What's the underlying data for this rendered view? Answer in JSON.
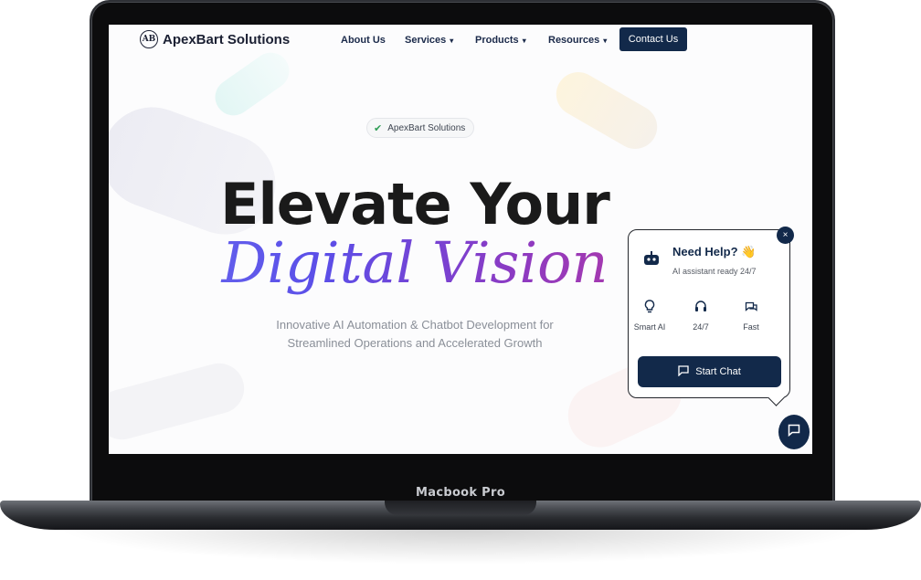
{
  "device": {
    "label": "Macbook Pro"
  },
  "nav": {
    "logo_mark": "AB",
    "logo_text": "ApexBart Solutions",
    "items": [
      {
        "label": "About Us",
        "dropdown": false
      },
      {
        "label": "Services",
        "dropdown": true
      },
      {
        "label": "Products",
        "dropdown": true
      },
      {
        "label": "Resources",
        "dropdown": true
      }
    ],
    "contact_label": "Contact Us"
  },
  "hero": {
    "badge": "ApexBart Solutions",
    "headline_line1": "Elevate Your",
    "headline_line2": "Digital Vision",
    "subtitle_line1": "Innovative AI Automation & Chatbot Development for",
    "subtitle_line2": "Streamlined Operations and Accelerated Growth"
  },
  "help_widget": {
    "title": "Need Help? 👋",
    "subtitle": "AI assistant ready 24/7",
    "features": [
      {
        "icon": "lightbulb-icon",
        "label": "Smart AI"
      },
      {
        "icon": "headset-icon",
        "label": "24/7"
      },
      {
        "icon": "chat-bubbles-icon",
        "label": "Fast"
      }
    ],
    "start_label": "Start Chat",
    "close_symbol": "×"
  },
  "colors": {
    "navy": "#12294a",
    "gradient_start": "#6a6ff0",
    "gradient_end": "#c0369a",
    "subtitle_gray": "#8a8f98"
  }
}
